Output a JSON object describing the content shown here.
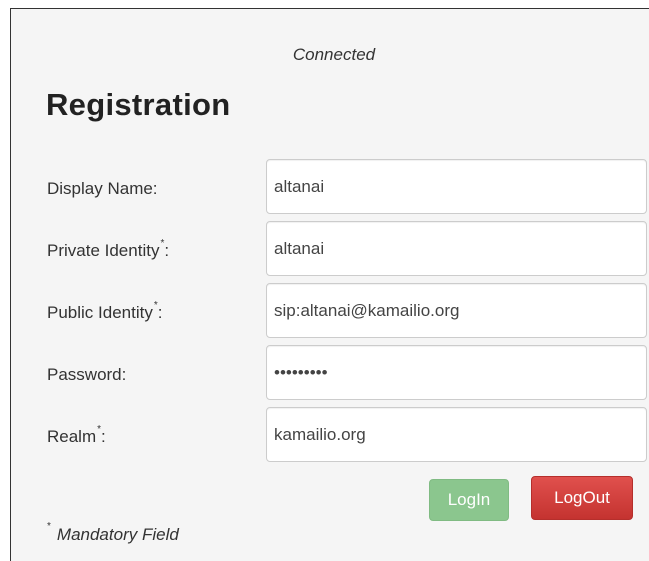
{
  "status": "Connected",
  "title": "Registration",
  "form": {
    "display_name": {
      "label": "Display Name:",
      "value": "altanai"
    },
    "private_identity": {
      "label": "Private Identity",
      "marker": "*",
      "suffix": ":",
      "value": "altanai"
    },
    "public_identity": {
      "label": "Public Identity",
      "marker": "*",
      "suffix": ":",
      "value": "sip:altanai@kamailio.org"
    },
    "password": {
      "label": "Password:",
      "value": "•••••••••"
    },
    "realm": {
      "label": "Realm",
      "marker": "*",
      "suffix": ":",
      "value": "kamailio.org"
    }
  },
  "buttons": {
    "login": "LogIn",
    "logout": "LogOut"
  },
  "footnote": {
    "marker": "*",
    "text": "Mandatory Field"
  },
  "colors": {
    "login_button": "#86c489",
    "logout_button": "#d9534f",
    "panel_background": "#f5f5f5"
  }
}
